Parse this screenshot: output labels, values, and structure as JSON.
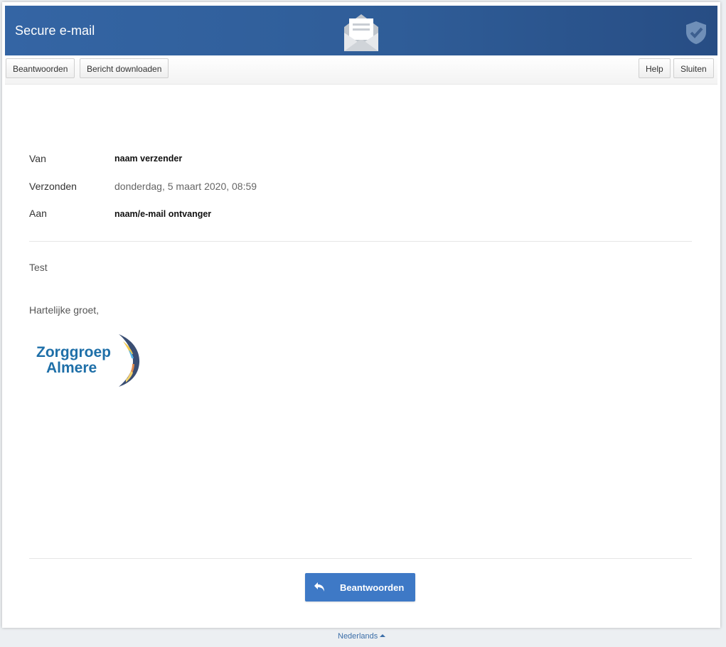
{
  "header": {
    "title": "Secure e-mail",
    "center_icon": "open-envelope-icon",
    "right_icon": "shield-check-icon",
    "colors": {
      "bar": "#2f5d98"
    }
  },
  "toolbar": {
    "reply_label": "Beantwoorden",
    "download_label": "Bericht downloaden",
    "help_label": "Help",
    "close_label": "Sluiten"
  },
  "message": {
    "from_label": "Van",
    "from_value": "naam verzender",
    "sent_label": "Verzonden",
    "sent_value": "donderdag, 5 maart 2020, 08:59",
    "to_label": "Aan",
    "to_value": "naam/e-mail ontvanger",
    "body_line1": "Test",
    "body_line2": "Hartelijke groet,",
    "logo_line1": "Zorggroep",
    "logo_line2": "Almere"
  },
  "footer": {
    "reply_button_label": "Beantwoorden",
    "reply_icon": "reply-arrow-icon",
    "reply_color": "#3e79c6",
    "language_label": "Nederlands",
    "language_icon": "caret-up-icon"
  }
}
